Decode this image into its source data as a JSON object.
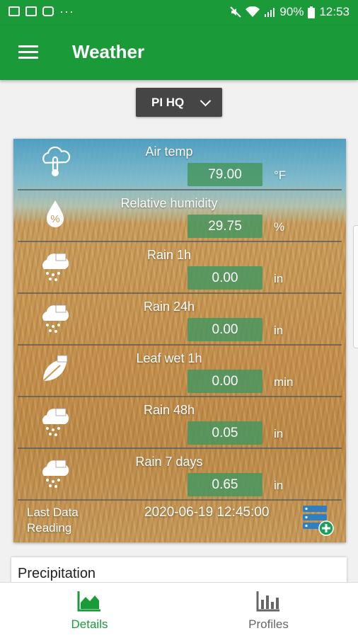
{
  "status_bar": {
    "battery": "90%",
    "time": "12:53",
    "left_icons": [
      "gallery-icon",
      "email-icon",
      "youtube-icon"
    ],
    "overflow": "···",
    "right_icons": [
      "mute-icon",
      "wifi-icon",
      "signal-icon",
      "battery-icon"
    ]
  },
  "app_bar": {
    "title": "Weather",
    "menu_icon": "hamburger-menu-icon",
    "color": "#1b9a3a"
  },
  "station_select": {
    "value": "PI HQ"
  },
  "readings": [
    {
      "icon": "thermometer-icon",
      "label": "Air temp",
      "value": "79.00",
      "unit": "°F"
    },
    {
      "icon": "humidity-icon",
      "label": "Relative humidity",
      "value": "29.75",
      "unit": "%"
    },
    {
      "icon": "rain-1h-icon",
      "label": "Rain 1h",
      "value": "0.00",
      "unit": "in"
    },
    {
      "icon": "rain-24h-icon",
      "label": "Rain 24h",
      "value": "0.00",
      "unit": "in"
    },
    {
      "icon": "leaf-wet-icon",
      "label": "Leaf wet 1h",
      "value": "0.00",
      "unit": "min"
    },
    {
      "icon": "rain-48h-icon",
      "label": "Rain 48h",
      "value": "0.05",
      "unit": "in"
    },
    {
      "icon": "rain-7d-icon",
      "label": "Rain 7 days",
      "value": "0.65",
      "unit": "in"
    }
  ],
  "last_reading": {
    "label_line1": "Last Data",
    "label_line2": "Reading",
    "timestamp": "2020-06-19 12:45:00",
    "action_icon": "database-add-icon"
  },
  "precipitation": {
    "title": "Precipitation"
  },
  "bottom_nav": {
    "items": [
      {
        "label": "Details",
        "icon": "area-chart-icon",
        "active": true
      },
      {
        "label": "Profiles",
        "icon": "bar-chart-icon",
        "active": false
      }
    ]
  }
}
